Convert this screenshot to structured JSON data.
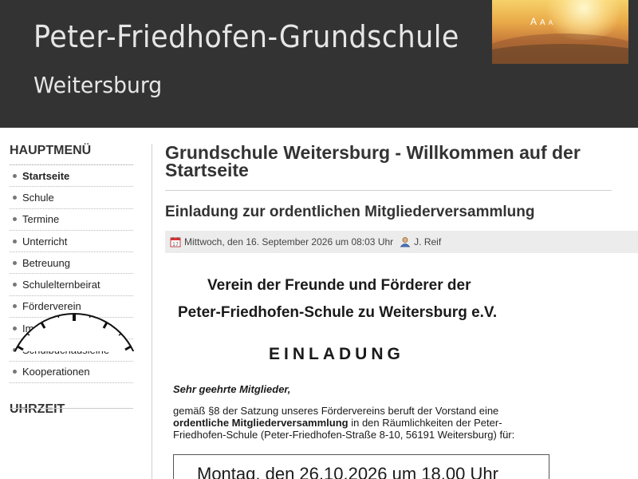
{
  "header": {
    "title": "Peter-Friedhofen-Grundschule",
    "subtitle": "Weitersburg",
    "font_tools": [
      "A",
      "A",
      "A"
    ]
  },
  "sidebar": {
    "menu_heading": "HAUPTMENÜ",
    "items": [
      {
        "label": "Startseite",
        "active": true
      },
      {
        "label": "Schule"
      },
      {
        "label": "Termine"
      },
      {
        "label": "Unterricht"
      },
      {
        "label": "Betreuung"
      },
      {
        "label": "Schulelternbeirat"
      },
      {
        "label": "Förderverein"
      },
      {
        "label": "Impressum"
      },
      {
        "label": "Schulbuchausleihe"
      },
      {
        "label": "Kooperationen"
      }
    ],
    "clock_heading": "UHRZEIT"
  },
  "main": {
    "page_title": "Grundschule Weitersburg - Willkommen auf der Startseite",
    "article": {
      "title": "Einladung zur ordentlichen Mitgliederversammlung",
      "date": "Mittwoch, den 16. September 2026 um 08:03 Uhr",
      "author": "J. Reif",
      "calendar_icon": "calendar-icon",
      "author_icon": "user-icon"
    },
    "document": {
      "org_line1": "Verein der Freunde und Förderer der",
      "org_line2": "Peter-Friedhofen-Schule zu Weitersburg e.V.",
      "heading": "EINLADUNG",
      "salutation": "Sehr geehrte Mitglieder,",
      "body_part1": "gemäß §8 der Satzung unseres Fördervereins beruft der Vorstand eine",
      "body_bold": "ordentliche Mitgliederversammlung",
      "body_part2": " in den Räumlichkeiten der Peter-Friedhofen-Schule (Peter-Friedhofen-Straße 8-10, 56191 Weitersburg) für:",
      "date_line": "Montag, den 26.10.2026 um 18.00 Uhr"
    }
  }
}
